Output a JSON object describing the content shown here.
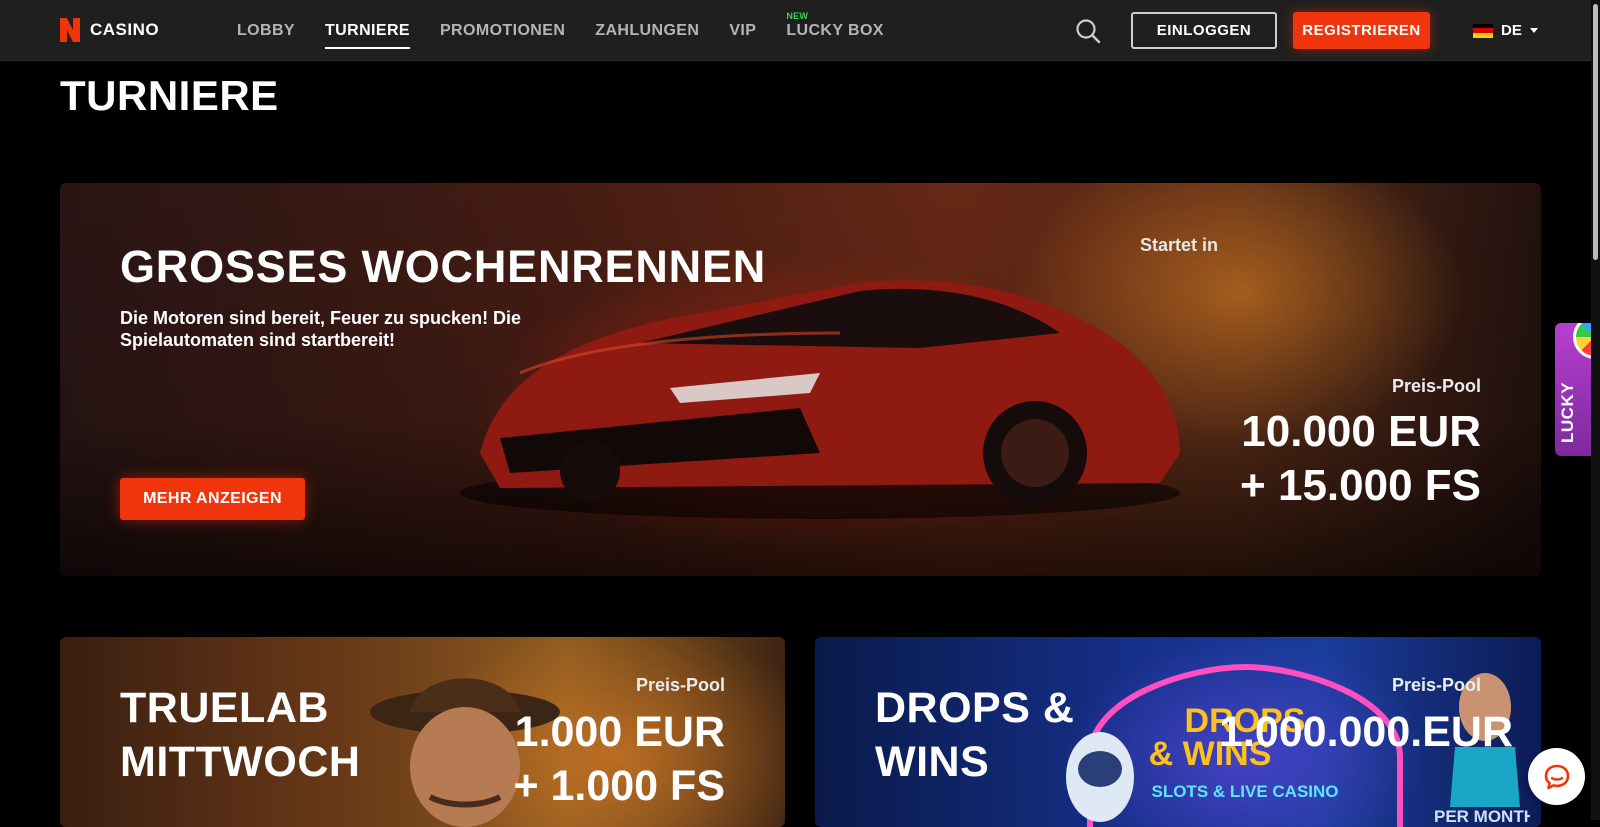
{
  "header": {
    "logo_text": "CASINO",
    "nav": [
      {
        "label": "LOBBY",
        "active": false
      },
      {
        "label": "TURNIERE",
        "active": true
      },
      {
        "label": "PROMOTIONEN",
        "active": false
      },
      {
        "label": "ZAHLUNGEN",
        "active": false
      },
      {
        "label": "VIP",
        "active": false
      },
      {
        "label": "LUCKY BOX",
        "active": false,
        "badge": "NEW"
      }
    ],
    "login_label": "EINLOGGEN",
    "register_label": "REGISTRIEREN",
    "language": "DE"
  },
  "page": {
    "title": "TURNIERE"
  },
  "hero": {
    "title": "GROSSES WOCHENRENNEN",
    "description": "Die Motoren sind bereit, Feuer zu spucken! Die Spielautomaten sind startbereit!",
    "starts_label": "Startet in",
    "pool_label": "Preis-Pool",
    "pool_line1": "10.000 EUR",
    "pool_line2": "+ 15.000 FS",
    "button_label": "MEHR ANZEIGEN"
  },
  "cards": [
    {
      "title_line1": "TRUELAB",
      "title_line2": "MITTWOCH",
      "pool_label": "Preis-Pool",
      "pool_line1": "1.000 EUR",
      "pool_line2": "+ 1.000 FS"
    },
    {
      "title_line1": "DROPS &",
      "title_line2": "WINS",
      "pool_label": "Preis-Pool",
      "pool_line1": "1.000.000.EUR",
      "pool_line2": "",
      "art_line1": "DROPS",
      "art_line2": "& WINS",
      "art_sub": "SLOTS & LIVE CASINO",
      "art_bottom": "PER MONTH"
    }
  ],
  "side_tab": {
    "label": "LUCKY"
  },
  "colors": {
    "accent": "#f0340c",
    "header_bg": "#1f1f1f",
    "new_badge": "#39d353"
  },
  "icons": {
    "search": "search-icon",
    "chat": "chat-icon",
    "caret": "caret-down-icon",
    "flag": "flag-de-icon"
  }
}
